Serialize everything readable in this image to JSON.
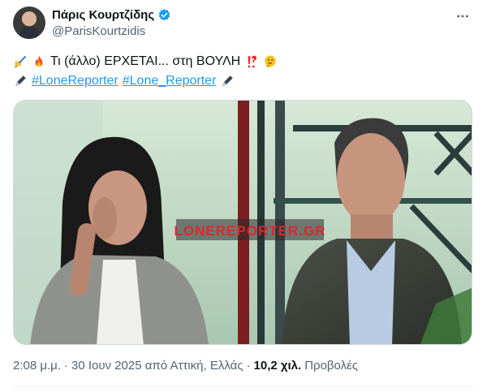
{
  "author": {
    "display_name": "Πάρις Κουρτζίδης",
    "handle": "@ParisKourtzidis"
  },
  "tweet": {
    "line1_text": "Τι (άλλο) ΕΡΧΕΤΑΙ... στη ΒΟΥΛΗ",
    "hashtag1": "#LoneReporter",
    "hashtag2": "#Lone_Reporter"
  },
  "media": {
    "watermark": "LONEREPORTER.GR"
  },
  "meta": {
    "time": "2:08 μ.μ.",
    "separator1": "·",
    "date_location": "30 Ιουν 2025 από Αττική, Ελλάς",
    "separator2": "·",
    "views_count": "10,2 χιλ.",
    "views_label": "Προβολές"
  },
  "icons": {
    "verified": "verified-badge-icon",
    "more": "more-horizontal-icon",
    "writing_hand": "writing-hand-emoji",
    "fire": "fire-emoji",
    "interrobang": "interrobang-emoji",
    "thinking": "thinking-face-emoji",
    "pen": "fountain-pen-emoji"
  },
  "colors": {
    "link": "#1d9bf0",
    "secondary_text": "#536471",
    "watermark_red": "#e0262b"
  }
}
